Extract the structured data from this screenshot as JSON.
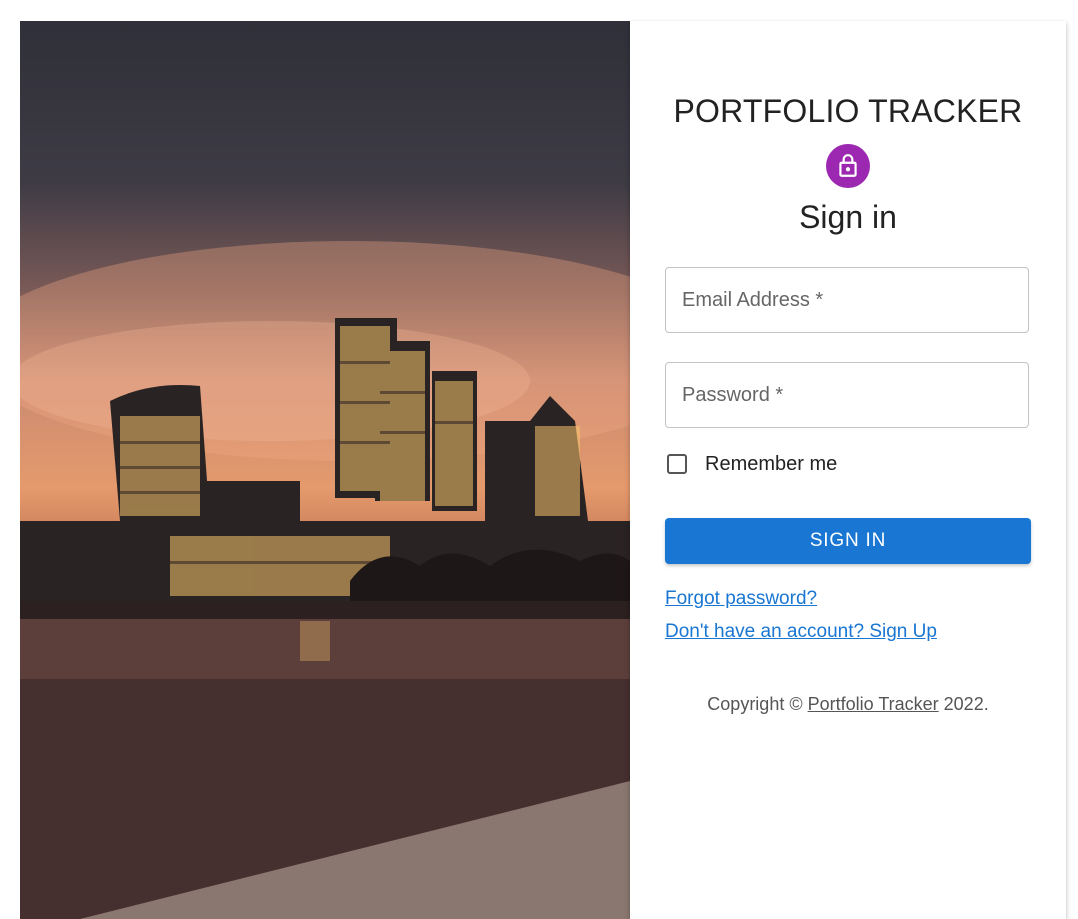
{
  "brand": {
    "title": "PORTFOLIO TRACKER"
  },
  "form": {
    "heading": "Sign in",
    "email_placeholder": "Email Address *",
    "password_placeholder": "Password *",
    "remember_label": "Remember me",
    "remember_checked": false,
    "submit_label": "SIGN IN"
  },
  "links": {
    "forgot": "Forgot password?",
    "signup": "Don't have an account? Sign Up"
  },
  "footer": {
    "prefix": "Copyright © ",
    "link_text": "Portfolio Tracker",
    "suffix": " 2022."
  },
  "icons": {
    "lock": "lock-icon"
  },
  "colors": {
    "primary": "#1976d2",
    "avatar": "#9c27b0"
  }
}
